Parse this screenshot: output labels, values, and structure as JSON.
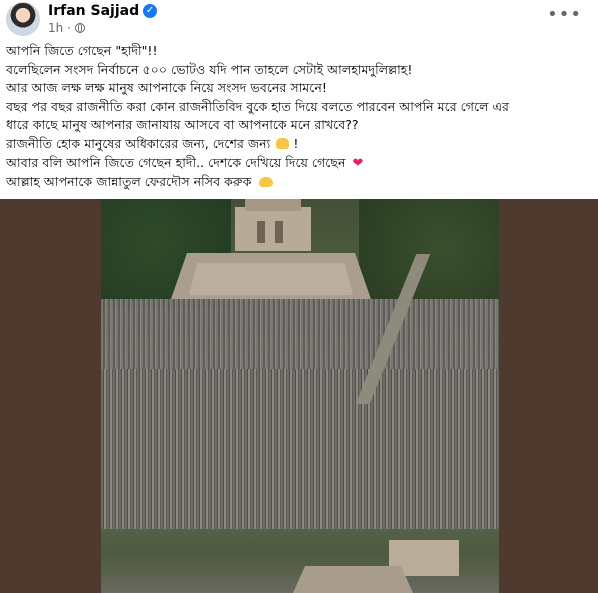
{
  "header": {
    "author": "Irfan Sajjad",
    "time": "1h",
    "privacy_icon": "globe-icon",
    "verified_icon": "verified-badge-icon",
    "more_icon": "more-options-icon"
  },
  "post": {
    "lines": [
      "আপনি জিতে গেছেন \"হাদী\"!!",
      "বলেছিলেন সংসদ নির্বাচনে ৫০০ ভোটও যদি পান তাহলে সেটাই আলহামদুলিল্লাহ!",
      "আর আজ লক্ষ লক্ষ মানুষ আপনাকে নিয়ে সংসদ ভবনের সামনে!",
      "বছর পর বছর রাজনীতি করা কোন রাজনীতিবিদ বুকে হাত দিয়ে বলতে পারবেন আপনি মরে গেলে এর",
      "ধারে কাছে মানুষ আপনার জানাযায় আসবে বা আপনাকে মনে রাখবে??",
      "রাজনীতি হোক মানুষের অধিকারের জন্য, দেশের জন্য",
      "আবার বলি আপনি জিতে গেছেন হাদী.. দেশকে দেখিয়ে দিয়ে গেছেন",
      "আল্লাহ আপনাকে জান্নাতুল ফেরদৌস নসিব করুক"
    ],
    "line6_suffix": "!",
    "emojis": {
      "line6": "fist-emoji",
      "line7": "red-heart-emoji",
      "line8": "praying-hands-emoji"
    }
  },
  "colors": {
    "author_text": "#050505",
    "meta_text": "#65676b",
    "verified_badge": "#1877f2",
    "photo_frame": "#4f3a30",
    "heart": "#e0245e"
  }
}
